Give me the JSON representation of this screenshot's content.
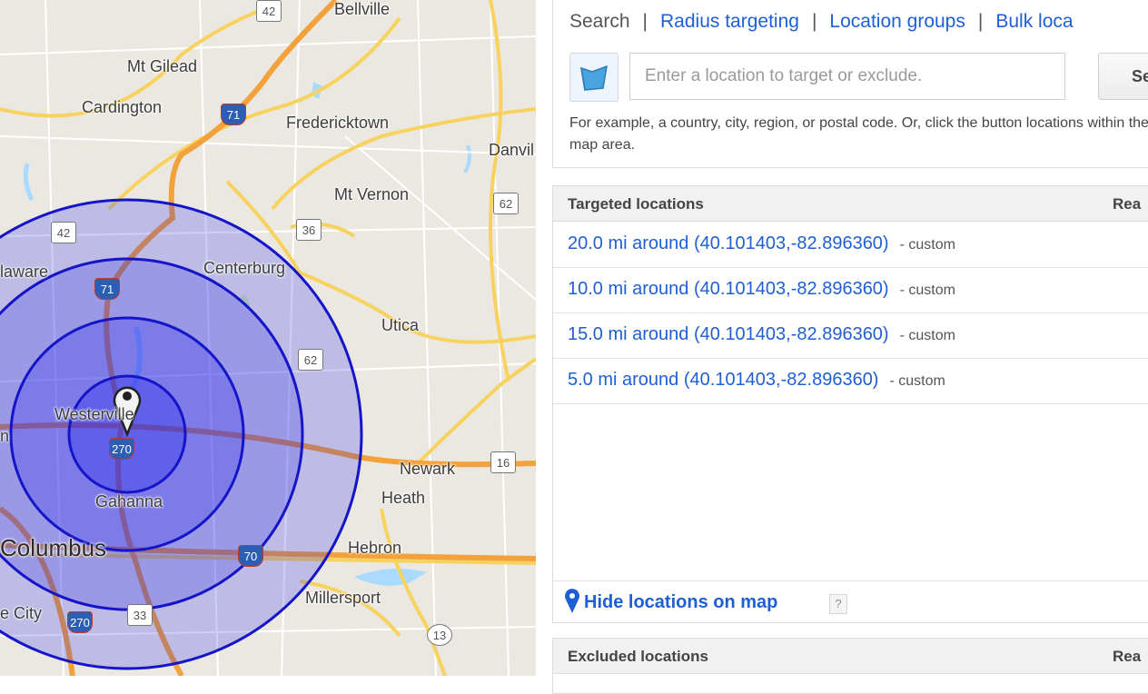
{
  "map": {
    "labels": {
      "bellville": "Bellville",
      "mt_gilead": "Mt Gilead",
      "cardington": "Cardington",
      "fredericktown": "Fredericktown",
      "danville": "Danvil",
      "mt_vernon": "Mt Vernon",
      "delaware": "laware",
      "centerburg": "Centerburg",
      "utica": "Utica",
      "westerville": "Westerville",
      "newark": "Newark",
      "heath": "Heath",
      "gahanna": "Gahanna",
      "columbus": "Columbus",
      "hebron": "Hebron",
      "millersport": "Millersport",
      "grove_city": "e City",
      "edge_n": "n"
    },
    "shields": {
      "r42_top": "42",
      "i71_top": "71",
      "r62": "62",
      "r36": "36",
      "r42_mid": "42",
      "i71_mid": "71",
      "r62_mid": "62",
      "i270": "270",
      "r16": "16",
      "i70": "70",
      "i270_s": "270",
      "r33": "33",
      "r13": "13"
    },
    "circle_color": "#2222ee"
  },
  "panel": {
    "tabs": {
      "search": "Search",
      "radius": "Radius targeting",
      "groups": "Location groups",
      "bulk": "Bulk loca"
    },
    "separator": "|",
    "input_placeholder": "Enter a location to target or exclude.",
    "search_button": "Se",
    "hint": "For example, a country, city, region, or postal code. Or, click the button locations within the map area.",
    "targeted": {
      "header": "Targeted locations",
      "header_right": "Rea",
      "rows": [
        {
          "label": "20.0 mi around (40.101403,-82.896360)",
          "tag": "- custom"
        },
        {
          "label": "10.0 mi around (40.101403,-82.896360)",
          "tag": "- custom"
        },
        {
          "label": "15.0 mi around (40.101403,-82.896360)",
          "tag": "- custom"
        },
        {
          "label": "5.0 mi around (40.101403,-82.896360)",
          "tag": "- custom"
        }
      ],
      "hide_link": "Hide locations on map",
      "help": "?"
    },
    "excluded": {
      "header": "Excluded locations",
      "header_right": "Rea"
    }
  }
}
